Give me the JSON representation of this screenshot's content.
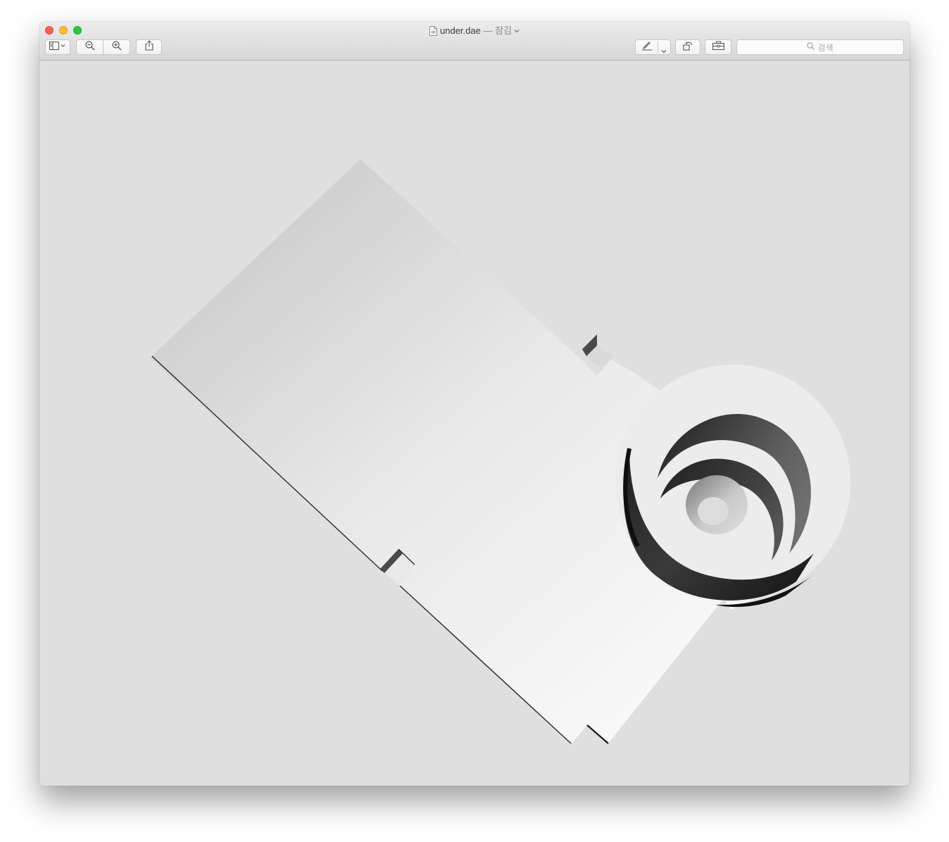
{
  "window": {
    "file_name": "under.dae",
    "title_separator": " — ",
    "title_status": "잠김"
  },
  "toolbar": {
    "sidebar_button": "sidebar-toggle-icon",
    "zoom_out_button": "zoom-out-icon",
    "zoom_in_button": "zoom-in-icon",
    "share_button": "share-icon",
    "markup_button": "markup-pen-icon",
    "rotate_button": "rotate-icon",
    "toolbox_button": "toolbox-icon",
    "search_placeholder": "검색"
  },
  "colors": {
    "close": "#fc5f57",
    "minimize": "#fdbb2e",
    "maximize": "#29c840",
    "canvas_background": "#dfdfdf"
  }
}
